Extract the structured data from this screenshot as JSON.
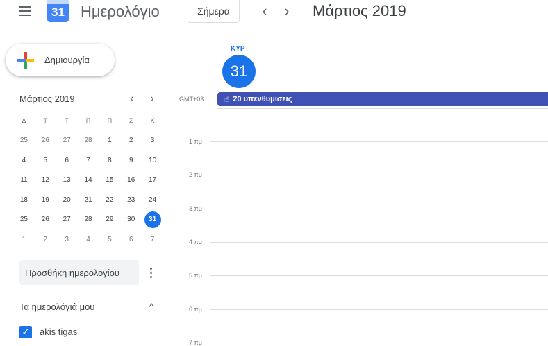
{
  "header": {
    "app_title": "Ημερολόγιο",
    "logo_day": "31",
    "today_button": "Σήμερα",
    "prev_icon": "‹",
    "next_icon": "›",
    "period": "Μάρτιος 2019"
  },
  "create": {
    "label": "Δημιουργία"
  },
  "mini_calendar": {
    "title": "Μάρτιος 2019",
    "prev_icon": "‹",
    "next_icon": "›",
    "weekdays": [
      "Δ",
      "Τ",
      "Τ",
      "Π",
      "Π",
      "Σ",
      "Κ"
    ],
    "weeks": [
      [
        "25",
        "26",
        "27",
        "28",
        "1",
        "2",
        "3"
      ],
      [
        "4",
        "5",
        "6",
        "7",
        "8",
        "9",
        "10"
      ],
      [
        "11",
        "12",
        "13",
        "14",
        "15",
        "16",
        "17"
      ],
      [
        "18",
        "19",
        "20",
        "21",
        "22",
        "23",
        "24"
      ],
      [
        "25",
        "26",
        "27",
        "28",
        "29",
        "30",
        "31"
      ],
      [
        "1",
        "2",
        "3",
        "4",
        "5",
        "6",
        "7"
      ]
    ],
    "today": "31"
  },
  "sidebar": {
    "add_calendar_placeholder": "Προσθήκη ημερολογίου",
    "my_calendars_label": "Τα ημερολόγιά μου",
    "collapse_icon": "^",
    "calendars": [
      {
        "name": "akis tigas",
        "checked": true,
        "color": "#1a73e8"
      }
    ]
  },
  "day_view": {
    "weekday": "ΚΥΡ",
    "day_number": "31",
    "timezone": "GMT+03",
    "reminders_label": "20 υπενθυμίσεις",
    "reminders_color": "#3f51b5",
    "hours": [
      "1 πμ",
      "2 πμ",
      "3 πμ",
      "4 πμ",
      "5 πμ",
      "6 πμ",
      "7 πμ"
    ]
  },
  "colors": {
    "accent": "#1a73e8"
  }
}
